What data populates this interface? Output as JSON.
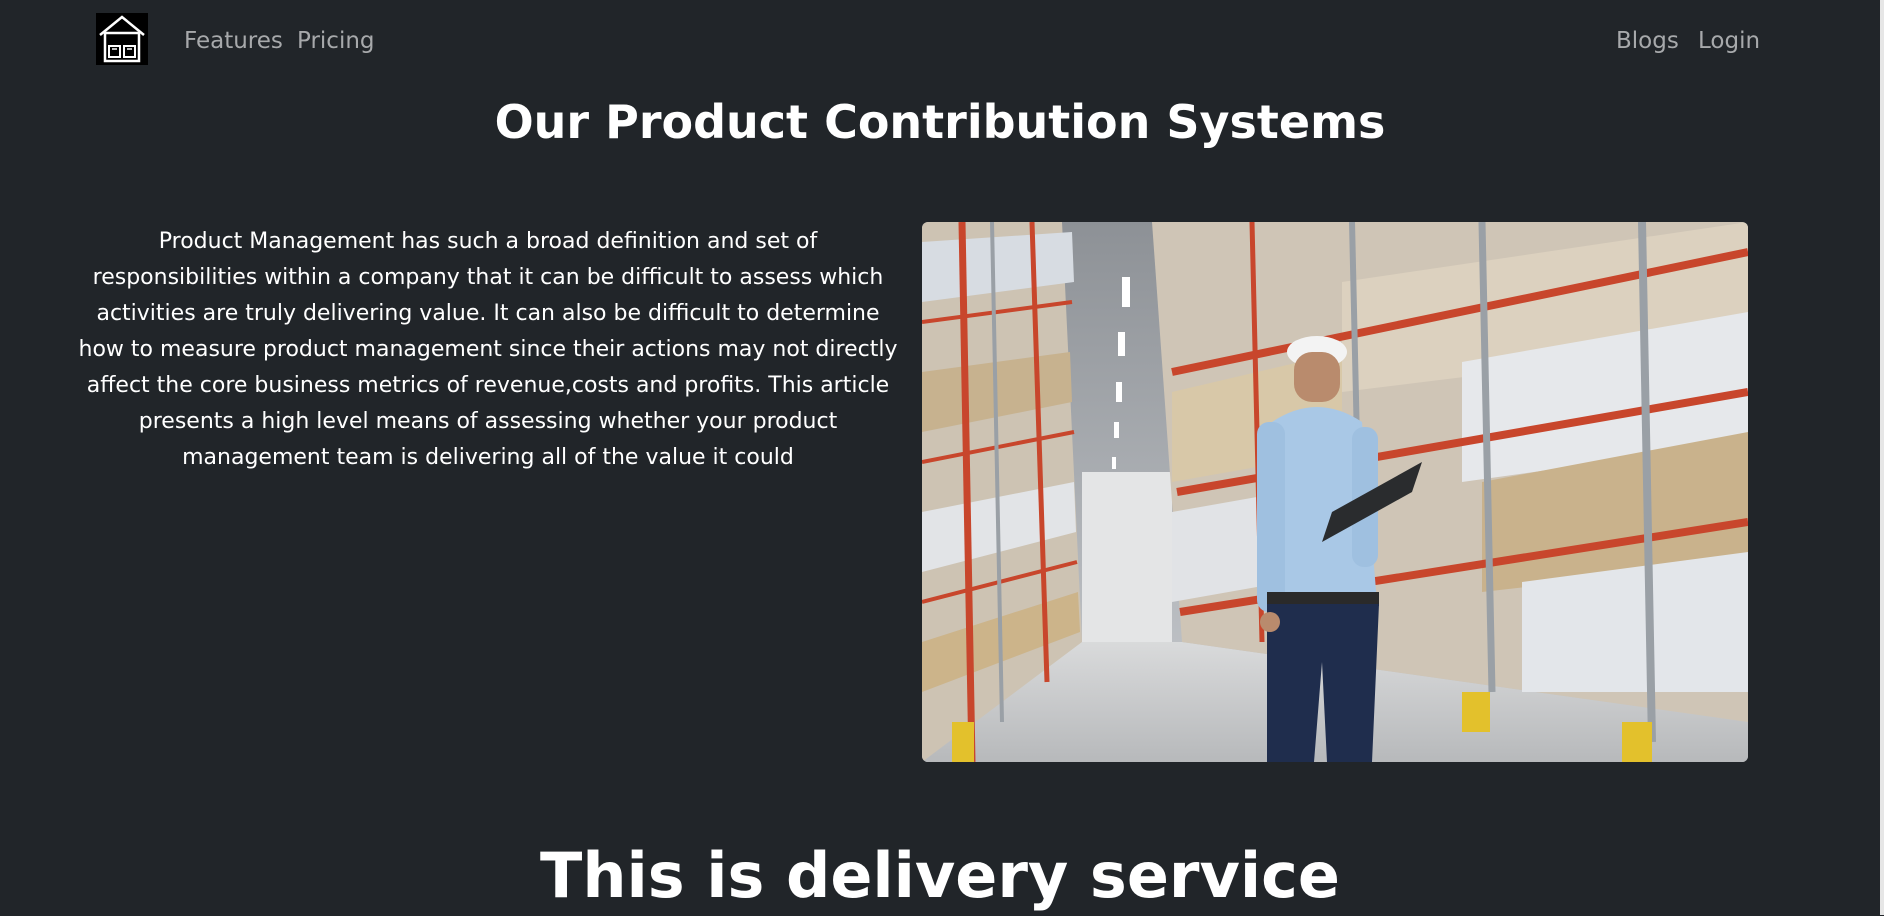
{
  "navbar": {
    "logo_icon": "warehouse-icon",
    "links_left": [
      {
        "label": "Features"
      },
      {
        "label": "Pricing"
      }
    ],
    "links_right": [
      {
        "label": "Blogs"
      },
      {
        "label": "Login"
      }
    ],
    "link_color": "#a7a9ab"
  },
  "main": {
    "title": "Our Product Contribution Systems",
    "intro": "Product Management has such a broad definition and set of responsibilities within a company that it can be difficult to assess which activities are truly delivering value. It can also be difficult to determine how to measure product management since their actions may not directly affect the core business metrics of revenue,costs and profits. This article presents a high level means of assessing whether your product management team is delivering all of the value it could",
    "image": "warehouse-worker-photo"
  },
  "delivery": {
    "title": "This is delivery service"
  },
  "colors": {
    "background": "#212529",
    "text": "#ffffff",
    "rack_red": "#c8462c"
  }
}
